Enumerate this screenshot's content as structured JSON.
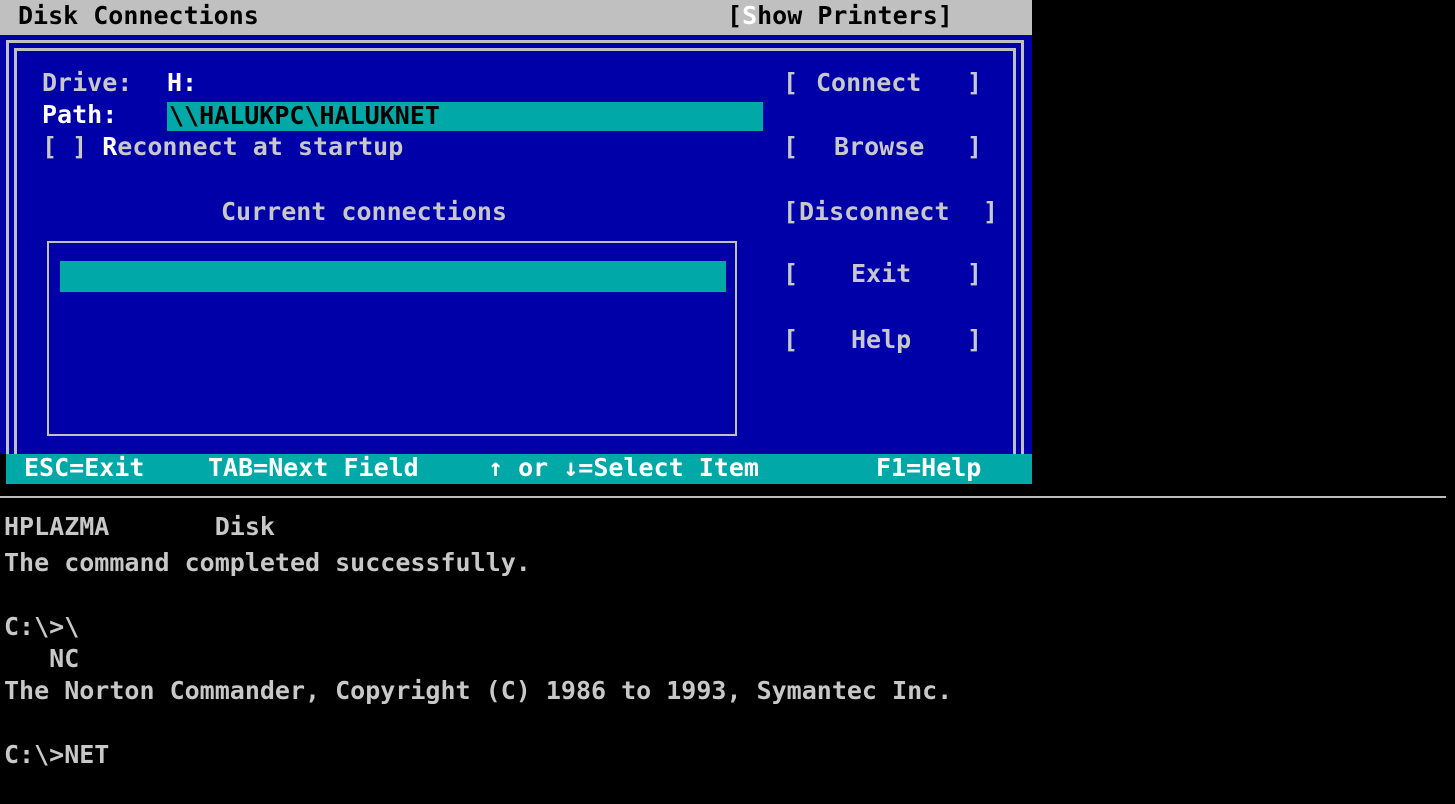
{
  "titlebar": {
    "title": "Disk Connections",
    "show_printers_pre": "[",
    "show_printers_hot": "S",
    "show_printers_rest": "how Printers]"
  },
  "dialog": {
    "drive_label": "Drive:",
    "drive_value": "H:",
    "path_label": "Path:",
    "path_value": "\\\\HALUKPC\\HALUKNET",
    "reconnect_checkbox": "[ ]",
    "reconnect_hot": "R",
    "reconnect_rest": "econnect at startup",
    "current_connections_label": "Current connections",
    "buttons": [
      {
        "open": "[",
        "label": "Connect",
        "close": "]"
      },
      {
        "open": "[",
        "label": "Browse",
        "close": "]"
      },
      {
        "open": "[",
        "label": "Disconnect",
        "close": "]"
      },
      {
        "open": "[",
        "label": "Exit",
        "close": "]"
      },
      {
        "open": "[",
        "label": "Help",
        "close": "]"
      }
    ]
  },
  "statusbar": {
    "esc": "ESC=Exit",
    "tab": "TAB=Next Field",
    "arrows": "↑ or ↓=Select Item",
    "f1": "F1=Help"
  },
  "console": {
    "lines": [
      "HPLAZMA       Disk",
      "The command completed successfully.",
      "",
      "C:\\>\\",
      "   NC",
      "The Norton Commander, Copyright (C) 1986 to 1993, Symantec Inc.",
      "",
      "C:\\>NET"
    ]
  },
  "colors": {
    "dialog_bg": "#0000a8",
    "accent_cyan": "#00a8a8",
    "titlebar_bg": "#c0c0c0"
  }
}
